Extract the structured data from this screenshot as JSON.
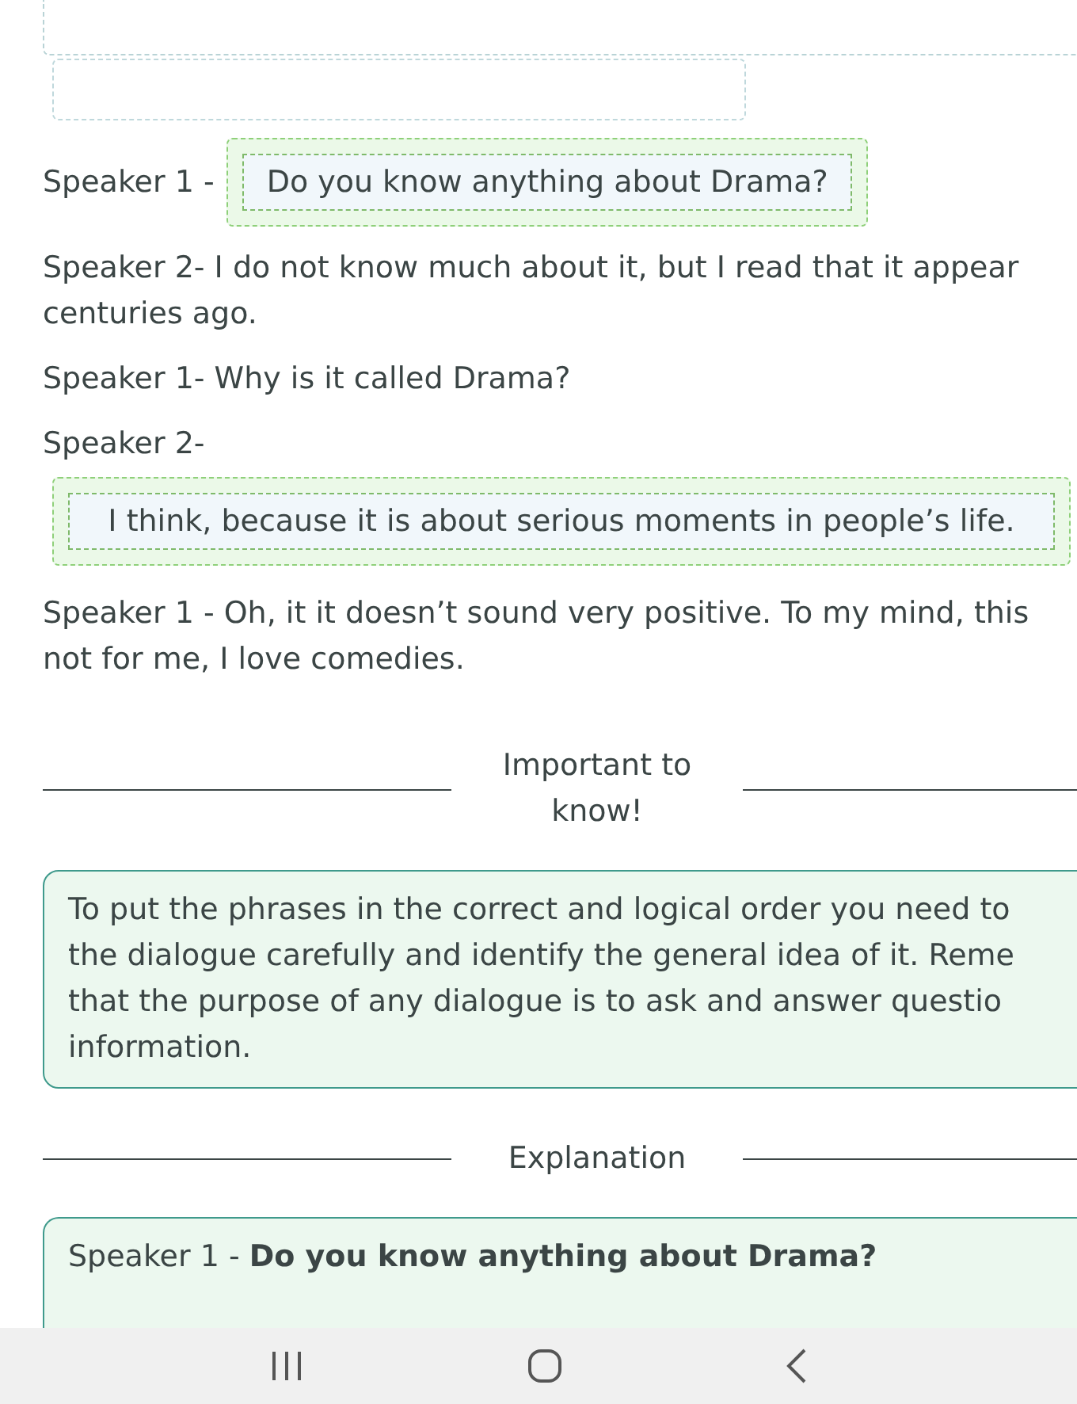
{
  "dialogue": [
    {
      "kind": "inline_answer",
      "speaker": "Speaker 1 -",
      "answer": "Do you know anything about Drama?"
    },
    {
      "kind": "text",
      "lines": [
        "Speaker 2- I do not know much about it, but I read that it appear",
        "centuries ago."
      ]
    },
    {
      "kind": "text",
      "lines": [
        "Speaker 1- Why is it called Drama?"
      ]
    },
    {
      "kind": "text",
      "lines": [
        "Speaker 2-"
      ]
    },
    {
      "kind": "block_answer",
      "answer": "I think, because it is about serious moments in people’s life."
    },
    {
      "kind": "text",
      "lines": [
        "Speaker 1 - Oh, it it doesn’t sound very positive. To my mind, this",
        "not for me, I love comedies."
      ]
    }
  ],
  "important": {
    "heading": "Important to know!",
    "lines": [
      "To put the phrases in the correct and logical order you need to",
      "the dialogue carefully and identify the general idea of it. Reme",
      "that the purpose of any dialogue is to ask and answer questio",
      "information."
    ]
  },
  "explanation": {
    "heading": "Explanation",
    "text": "Speaker 1 - **Do you know anything about Drama?**"
  }
}
